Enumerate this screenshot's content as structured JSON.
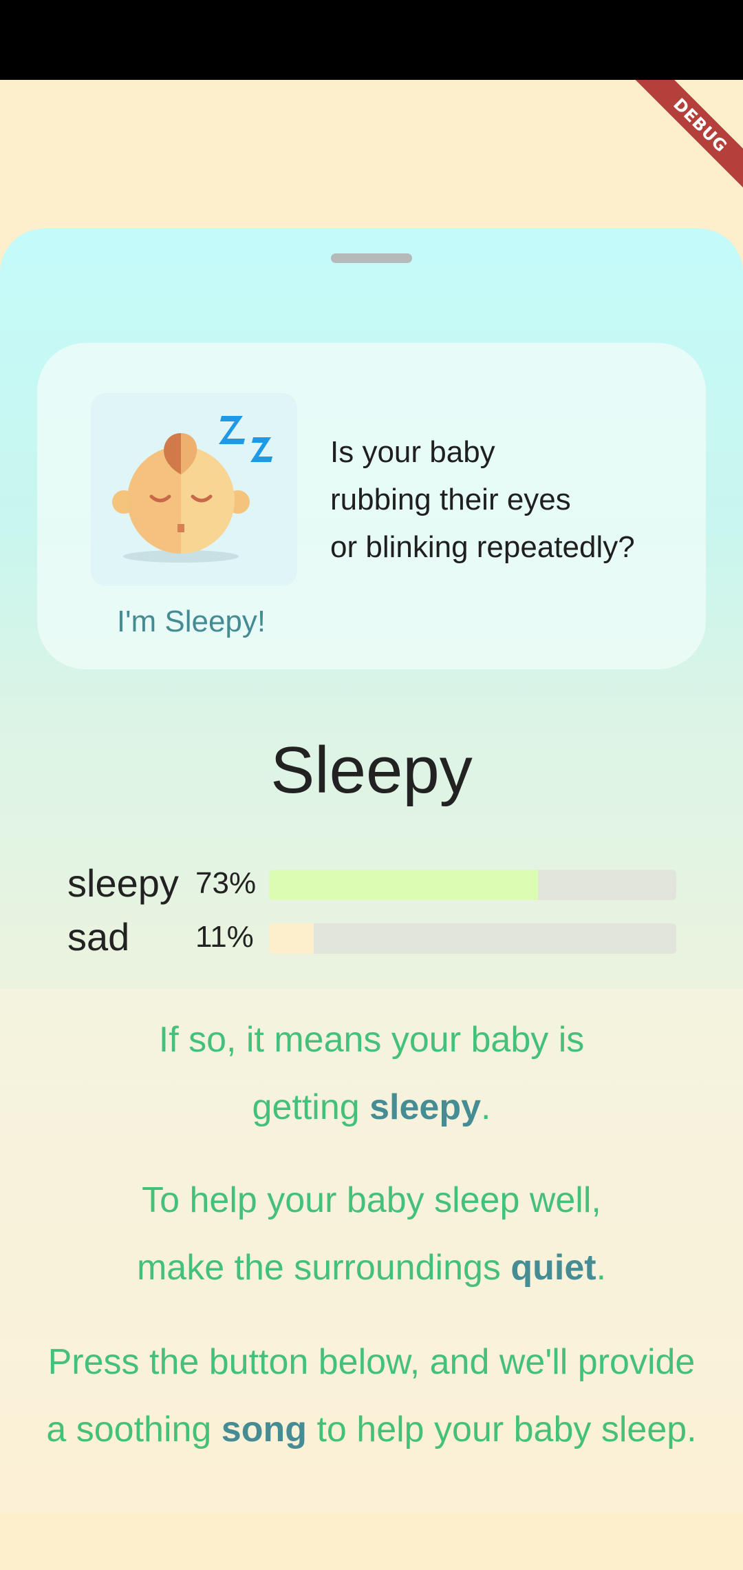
{
  "debug_banner": {
    "label": "DEBUG"
  },
  "card": {
    "caption": "I'm Sleepy!",
    "question_lines": [
      "Is your baby",
      "rubbing their eyes",
      "or blinking repeatedly?"
    ],
    "icon": "sleeping-baby-icon"
  },
  "result": {
    "title": "Sleepy",
    "bars": [
      {
        "label": "sleepy",
        "percent_text": "73%",
        "value": 0.66,
        "color": "#dcfcb4"
      },
      {
        "label": "sad",
        "percent_text": "11%",
        "value": 0.11,
        "color": "#fdefcb"
      }
    ]
  },
  "advice": {
    "p1_line1": "If so, it means your baby is",
    "p1_line2_pre": "getting ",
    "p1_line2_bold": "sleepy",
    "p1_line2_post": ".",
    "p2_line1": "To help your baby sleep well,",
    "p2_line2_pre": "make the surroundings ",
    "p2_line2_bold": "quiet",
    "p2_line2_post": ".",
    "p3_line1": "Press the button below, and we'll provide",
    "p3_line2_pre": "a soothing ",
    "p3_line2_bold": "song",
    "p3_line2_post": " to help your baby sleep."
  },
  "colors": {
    "background": "#fdefcb",
    "accent_green": "#44c07a",
    "accent_teal": "#468c94",
    "debug_red": "#b3403a"
  }
}
